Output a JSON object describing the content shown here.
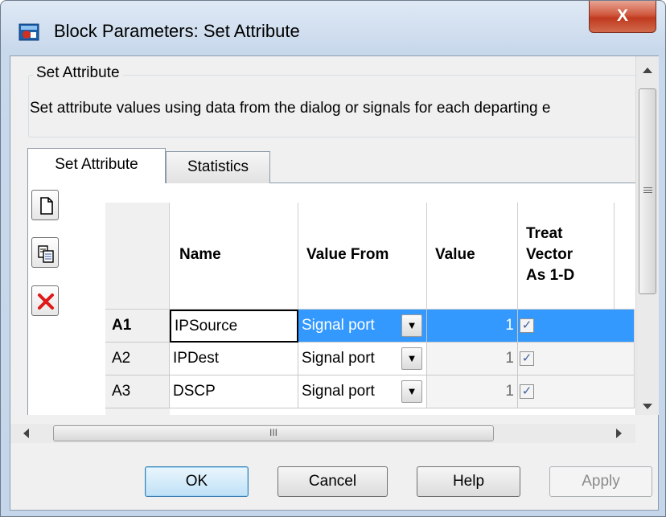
{
  "window": {
    "title": "Block Parameters: Set Attribute",
    "close_label": "X"
  },
  "groupbox": {
    "legend": "Set Attribute",
    "description": "Set attribute values using data from the dialog or signals for each departing e"
  },
  "tabs": [
    {
      "label": "Set Attribute",
      "selected": true
    },
    {
      "label": "Statistics",
      "selected": false
    }
  ],
  "toolbar": {
    "icons": [
      "new-row-icon",
      "copy-row-icon",
      "delete-row-icon"
    ]
  },
  "table": {
    "columns": [
      "Name",
      "Value From",
      "Value",
      "Treat\nVector\nAs 1-D"
    ],
    "rows": [
      {
        "id": "A1",
        "name": "IPSource",
        "value_from": "Signal port",
        "value": "1",
        "treat_vector": true,
        "selected": true
      },
      {
        "id": "A2",
        "name": "IPDest",
        "value_from": "Signal port",
        "value": "1",
        "treat_vector": true,
        "selected": false
      },
      {
        "id": "A3",
        "name": "DSCP",
        "value_from": "Signal port",
        "value": "1",
        "treat_vector": true,
        "selected": false
      }
    ]
  },
  "scrollbar": {
    "hthumb_grip": "III"
  },
  "buttons": {
    "ok": "OK",
    "cancel": "Cancel",
    "help": "Help",
    "apply": "Apply"
  },
  "colors": {
    "selection": "#3399ff",
    "apply_disabled": "#8a8a8a"
  }
}
